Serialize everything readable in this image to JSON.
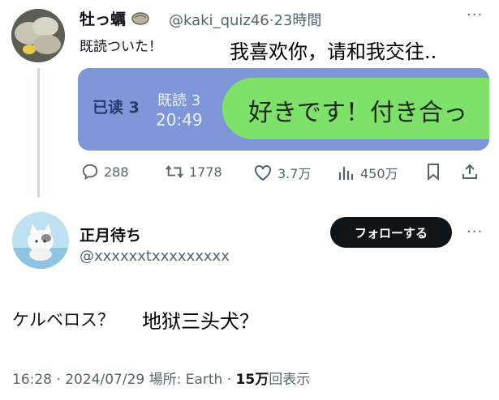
{
  "tweet1": {
    "author_name": "牡っ蠣",
    "handle": "@kaki_quiz46",
    "separator": "·",
    "time_ago": "23時間",
    "more_label": "···",
    "text": "既読ついた！",
    "overlay_text": "我喜欢你，请和我交往..",
    "image": {
      "read_label_zh": "已读 3",
      "read_label_jp": "既読 3",
      "time": "20:49",
      "bubble_text": "好きです！付き合っ"
    },
    "actions": {
      "replies": "288",
      "retweets": "1778",
      "likes": "3.7万",
      "views": "450万"
    }
  },
  "tweet2": {
    "author_name": "正月待ち",
    "handle": "@xxxxxxtxxxxxxxxx",
    "follow_label": "フォローする",
    "more_label": "···",
    "text": "ケルベロス？",
    "overlay_text": "地狱三头犬？",
    "meta": {
      "time": "16:28",
      "separator1": " · ",
      "date": "2024/07/29",
      "location": " 場所: Earth",
      "separator2": " · ",
      "views_count": "15万",
      "views_label": "回表示"
    }
  },
  "icons": [
    "oyster-icon",
    "reply-icon",
    "retweet-icon",
    "like-icon",
    "views-icon",
    "bookmark-icon",
    "share-icon"
  ]
}
